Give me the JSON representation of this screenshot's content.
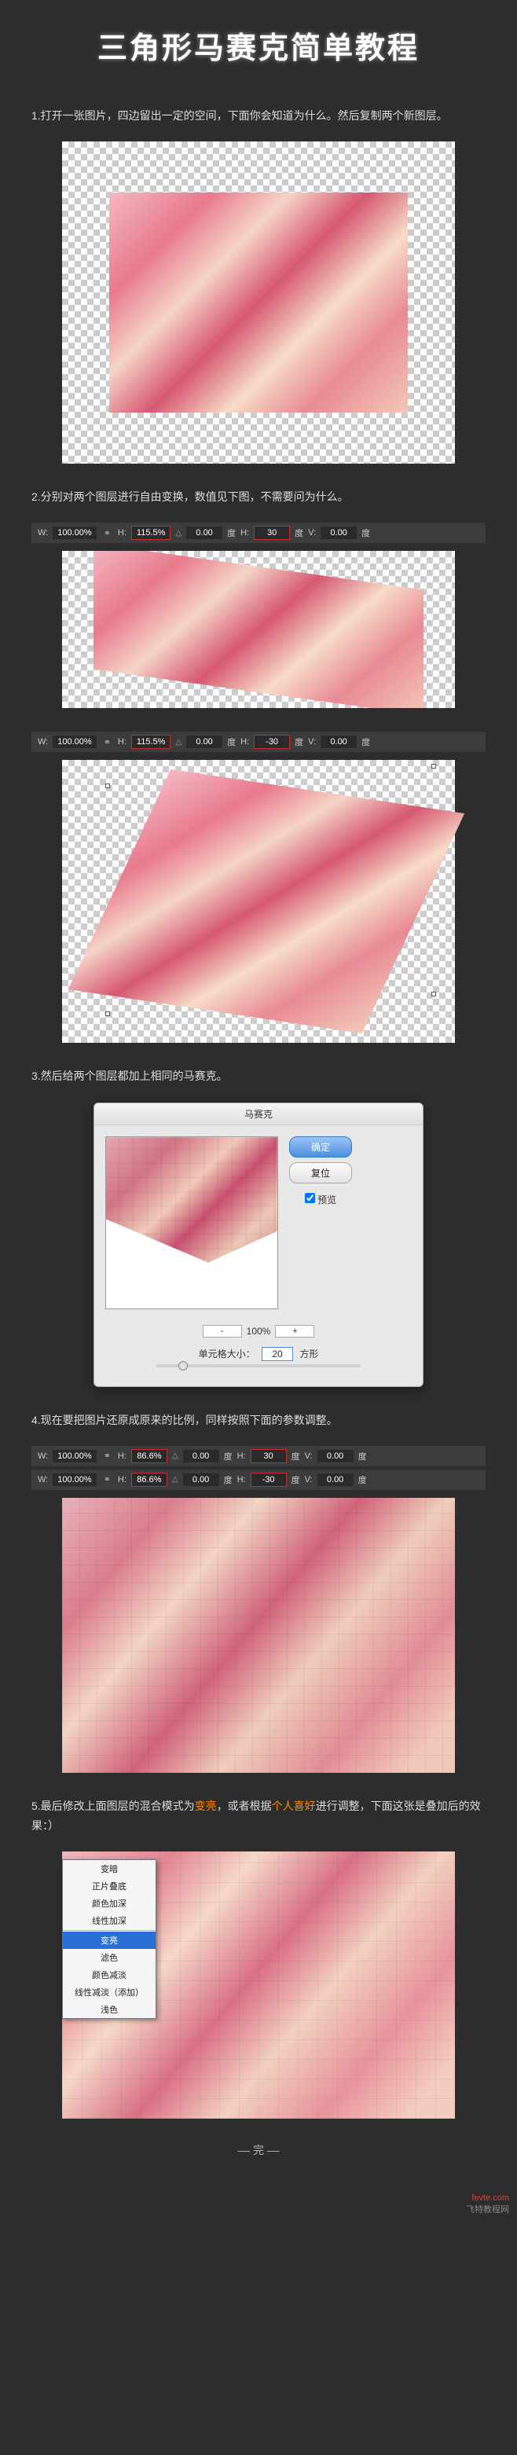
{
  "title": "三角形马赛克简单教程",
  "steps": {
    "s1": "1.打开一张图片，四边留出一定的空间，下面你会知道为什么。然后复制两个新图层。",
    "s2": "2.分别对两个图层进行自由变换，数值见下图，不需要问为什么。",
    "s3": "3.然后给两个图层都加上相同的马赛克。",
    "s4": "4.现在要把图片还原成原来的比例，同样按照下面的参数调整。",
    "s5a": "5.最后修改上面图层的混合模式为",
    "s5b": "变亮",
    "s5c": "，或者根据",
    "s5d": "个人喜好",
    "s5e": "进行调整，下面这张是叠加后的效果：）"
  },
  "transform_labels": {
    "W": "W:",
    "H": "H:",
    "deg": "度",
    "V": "V:",
    "rot": "H:",
    "skew": "△"
  },
  "bars": {
    "bar1": {
      "W": "100.00%",
      "H": "115.5%",
      "skew": "0.00",
      "rot": "30",
      "V": "0.00"
    },
    "bar2": {
      "W": "100.00%",
      "H": "115.5%",
      "skew": "0.00",
      "rot": "-30",
      "V": "0.00"
    },
    "bar3": {
      "W": "100.00%",
      "H": "86.6%",
      "skew": "0.00",
      "rot": "30",
      "V": "0.00"
    },
    "bar4": {
      "W": "100.00%",
      "H": "86.6%",
      "skew": "0.00",
      "rot": "-30",
      "V": "0.00"
    }
  },
  "mosaic": {
    "title": "马赛克",
    "ok": "确定",
    "reset": "复位",
    "preview": "预览",
    "zoom_minus": "-",
    "zoom_val": "100%",
    "zoom_plus": "+",
    "cell_label_pre": "单元格大小：",
    "cell_val": "20",
    "cell_label_post": "方形"
  },
  "blend_modes": {
    "items": [
      "变暗",
      "正片叠底",
      "颜色加深",
      "线性加深"
    ],
    "selected": "变亮",
    "items2": [
      "滤色",
      "颜色减淡",
      "线性减淡（添加）",
      "浅色"
    ]
  },
  "end": "–– 完 ––",
  "footer_brand": "fevte.com",
  "footer_sub": "飞特教程网"
}
